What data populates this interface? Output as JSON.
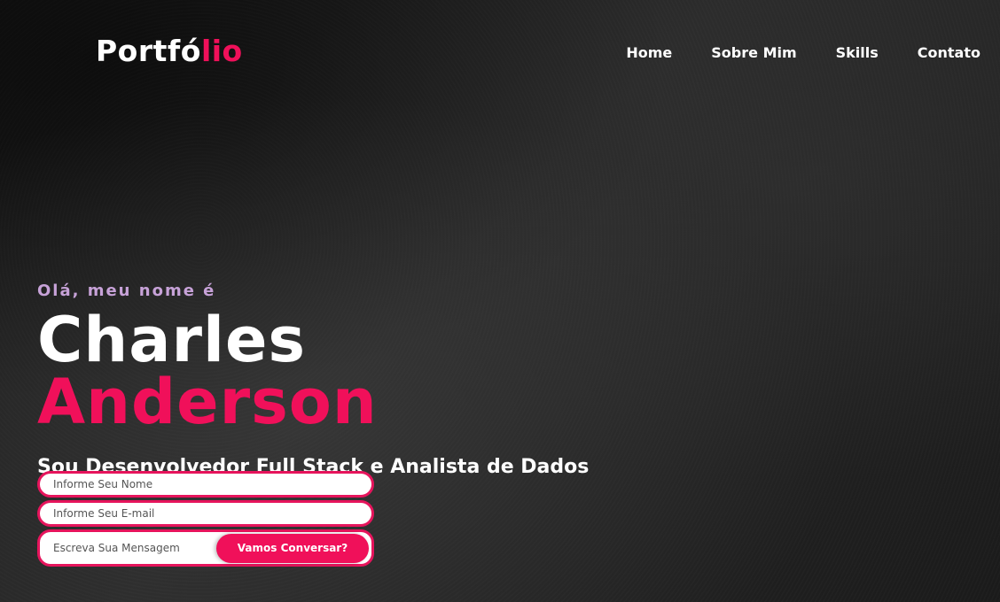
{
  "brand": {
    "logo_main": "Portfó",
    "logo_accent": "lio"
  },
  "nav": {
    "items": [
      {
        "label": "Home"
      },
      {
        "label": "Sobre Mim"
      },
      {
        "label": "Skills"
      },
      {
        "label": "Contato"
      }
    ]
  },
  "hero": {
    "greeting": "Olá, meu nome é",
    "first_name": "Charles",
    "last_name": "Anderson",
    "subtitle": "Sou Desenvolvedor Full Stack e Analista de Dados"
  },
  "contact_form": {
    "name_placeholder": "Informe Seu Nome",
    "email_placeholder": "Informe Seu E-mail",
    "message_placeholder": "Escreva Sua Mensagem",
    "submit_label": "Vamos Conversar?"
  },
  "colors": {
    "accent": "#f0105a",
    "greeting": "#c7a2d8",
    "background": "#202020"
  }
}
